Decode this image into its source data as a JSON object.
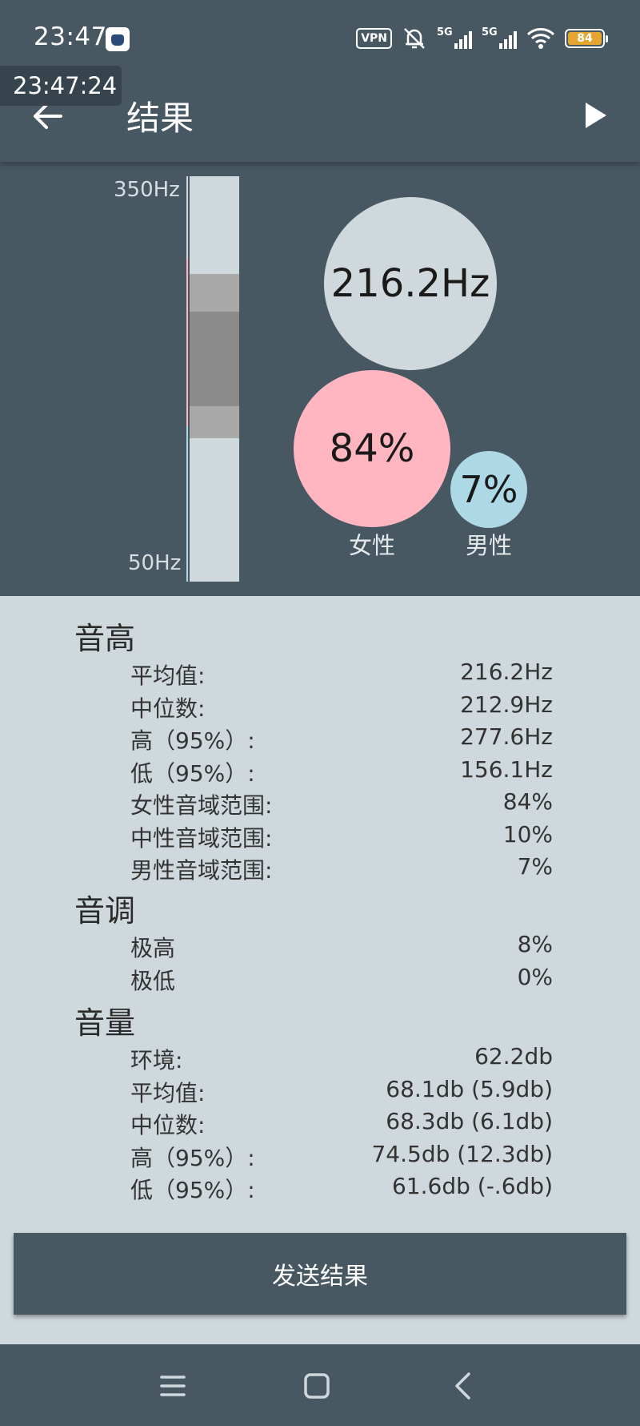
{
  "status_bar": {
    "time": "23:47",
    "vpn_label": "VPN",
    "sim1_label": "5G",
    "sim2_label": "5G",
    "battery_level": "84"
  },
  "overlay": {
    "timestamp": "23:47:24"
  },
  "app_bar": {
    "title": "结果"
  },
  "chart_data": {
    "type": "range-bar",
    "axis": {
      "max_label": "350Hz",
      "min_label": "50Hz",
      "range_hz": [
        50,
        350
      ]
    },
    "band_outer_hz": [
      156.1,
      277.6
    ],
    "band_inner_hz": [
      180,
      250
    ],
    "female_range_hz": [
      165,
      289
    ],
    "male_range_hz": [
      50,
      165
    ],
    "bubbles": {
      "mean_label": "216.2Hz",
      "female_label": "84%",
      "female_caption": "女性",
      "male_label": "7%",
      "male_caption": "男性"
    },
    "colors": {
      "female": "#ffb6c1",
      "male": "#add8e6",
      "neutral": "#cfd8dc"
    }
  },
  "stats": {
    "pitch": {
      "title": "音高",
      "rows": [
        {
          "label": "平均值:",
          "value": "216.2Hz"
        },
        {
          "label": "中位数:",
          "value": "212.9Hz"
        },
        {
          "label": "高（95%）:",
          "value": "277.6Hz"
        },
        {
          "label": "低（95%）:",
          "value": "156.1Hz"
        },
        {
          "label": "女性音域范围:",
          "value": "84%"
        },
        {
          "label": "中性音域范围:",
          "value": "10%"
        },
        {
          "label": "男性音域范围:",
          "value": "7%"
        }
      ]
    },
    "tone": {
      "title": "音调",
      "rows": [
        {
          "label": "极高",
          "value": "8%"
        },
        {
          "label": "极低",
          "value": "0%"
        }
      ]
    },
    "volume": {
      "title": "音量",
      "rows": [
        {
          "label": "环境:",
          "value": "62.2db"
        },
        {
          "label": "平均值:",
          "value": "68.1db (5.9db)"
        },
        {
          "label": "中位数:",
          "value": "68.3db (6.1db)"
        },
        {
          "label": "高（95%）:",
          "value": "74.5db (12.3db)"
        },
        {
          "label": "低（95%）:",
          "value": "61.6db (-.6db)"
        }
      ]
    }
  },
  "send_button": {
    "label": "发送结果"
  },
  "nav_bar": {
    "items": [
      "menu-icon",
      "home-icon",
      "back-icon"
    ]
  }
}
